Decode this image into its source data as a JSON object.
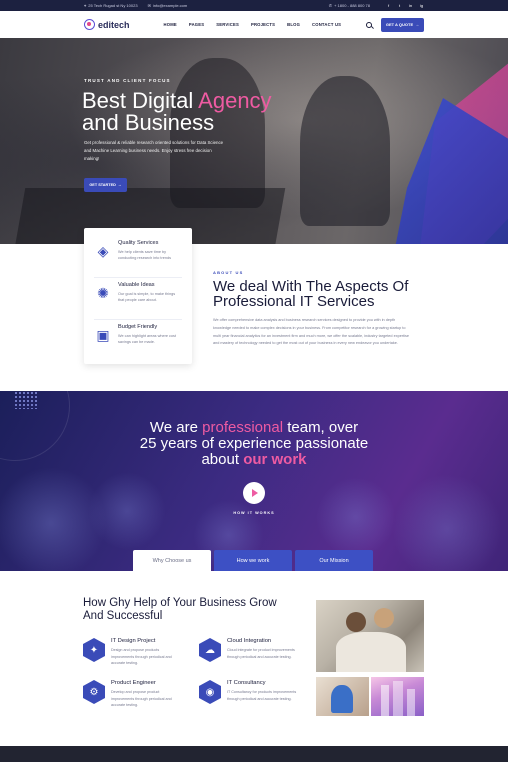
{
  "topbar": {
    "address": "25 Tech Rugad st Ny 10023",
    "email": "info@example.com",
    "phone": "+ 1800 - 888 800 78",
    "social": [
      "f",
      "t",
      "in",
      "ig"
    ]
  },
  "nav": {
    "brand": "editech",
    "items": [
      "HOME",
      "PAGES",
      "SERVICES",
      "PROJECTS",
      "BLOG",
      "CONTACT US"
    ],
    "cta": "GET A QUOTE"
  },
  "hero": {
    "eyebrow": "TRUST AND CLIENT FOCUS",
    "title_1": "Best Digital ",
    "title_accent": "Agency",
    "title_2": "and Business",
    "subtitle": "Get professional & reliable research oriented solutions for Data Science and Machine Learning business needs. Enjoy stress free decision making!",
    "cta": "GET STARTED"
  },
  "features": [
    {
      "title": "Quality Services",
      "text": "We help clients save time by conducting research into trends"
    },
    {
      "title": "Valuable Ideas",
      "text": "Our goal is simple, to make things that people care about."
    },
    {
      "title": "Budget Friendly",
      "text": "We can highlight areas where cost savings can be made."
    }
  ],
  "about": {
    "eyebrow": "ABOUT US",
    "title": "We deal With The Aspects Of Professional IT Services",
    "body": "We offer comprehensive data analysis and business research services designed to provide you with in depth knowledge needed to make complex decisions in your business. From competitor research for a growing startup to multi year financial analytics for an investment firm and much more, we offer the scalable, industry targeted expertise and mastery of technology needed to get the most out of your business in every new endeavor you undertake."
  },
  "team": {
    "line1_a": "We are ",
    "line1_pink": "professional",
    "line1_b": " team, over",
    "line2": "25 years of experience passionate",
    "line3_a": "about ",
    "line3_pink": "our work",
    "how": "HOW IT WORKS",
    "tabs": [
      "Why Choose us",
      "How we work",
      "Our Mission"
    ]
  },
  "help": {
    "title": "How Ghy Help of Your Business Grow And Successful",
    "services": [
      {
        "title": "IT Design Project",
        "text": "Design and propose products improvements through periodical and accurate testing."
      },
      {
        "title": "Cloud Integration",
        "text": "Cloud integrate for product improvements through periodical and accurate testing."
      },
      {
        "title": "Product Engineer",
        "text": "Develop and propose product improvements through periodical and accurate testing."
      },
      {
        "title": "IT Consultancy",
        "text": "IT Consultancy for products improvements through periodical and accurate testing."
      }
    ]
  }
}
